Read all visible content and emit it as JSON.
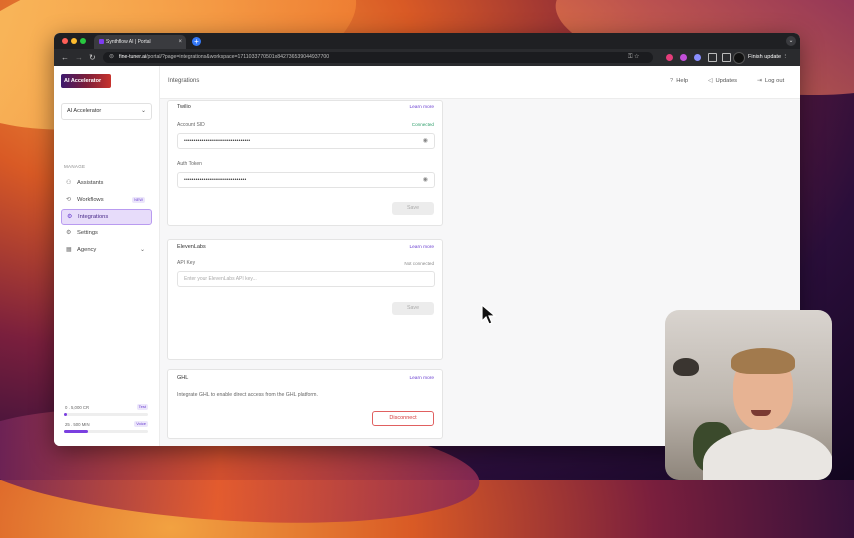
{
  "browser": {
    "tab_title": "Synthflow AI | Portal",
    "tab_close": "×",
    "new_tab": "+",
    "url_host": "fine-tuner.ai",
    "url_path": "/portal/?page=integrations&workspace=1711033770501x842736539044937700",
    "finish_update": "Finish update ⋮"
  },
  "sidebar": {
    "logo_text": "AI Accelerator",
    "workspace": "AI Accelerator",
    "section_label": "MANAGE",
    "items": [
      {
        "label": "Assistants",
        "icon": "user-icon"
      },
      {
        "label": "Workflows",
        "icon": "workflow-icon",
        "badge": "NEW"
      },
      {
        "label": "Integrations",
        "icon": "plug-icon",
        "active": true
      },
      {
        "label": "Settings",
        "icon": "gear-icon"
      },
      {
        "label": "Agency",
        "icon": "building-icon"
      }
    ],
    "usage": [
      {
        "text": "0 . 5,000 CR",
        "badge": "Test",
        "fraction": 0.03
      },
      {
        "text": "25 . 500 MIN",
        "badge": "Voice",
        "fraction": 0.28
      }
    ]
  },
  "topbar": {
    "title": "Integrations",
    "help": "Help",
    "updates": "Updates",
    "logout": "Log out"
  },
  "cards": {
    "twilio": {
      "title": "Twilio",
      "learn_more": "Learn more",
      "sid_label": "Account SID",
      "status": "Connected",
      "sid_value": "••••••••••••••••••••••••••••••••••",
      "token_label": "Auth Token",
      "token_value": "••••••••••••••••••••••••••••••••",
      "save": "Save"
    },
    "elevenlabs": {
      "title": "ElevenLabs",
      "learn_more": "Learn more",
      "key_label": "API Key",
      "status": "Not connected",
      "placeholder": "Enter your ElevenLabs API key...",
      "save": "Save"
    },
    "ghl": {
      "title": "GHL",
      "learn_more": "Learn more",
      "description": "Integrate GHL to enable direct access from the GHL platform.",
      "disconnect": "Disconnect"
    }
  },
  "colors": {
    "accent": "#6a3fd0",
    "connected": "#2e9e6a",
    "danger": "#d43b3b"
  }
}
